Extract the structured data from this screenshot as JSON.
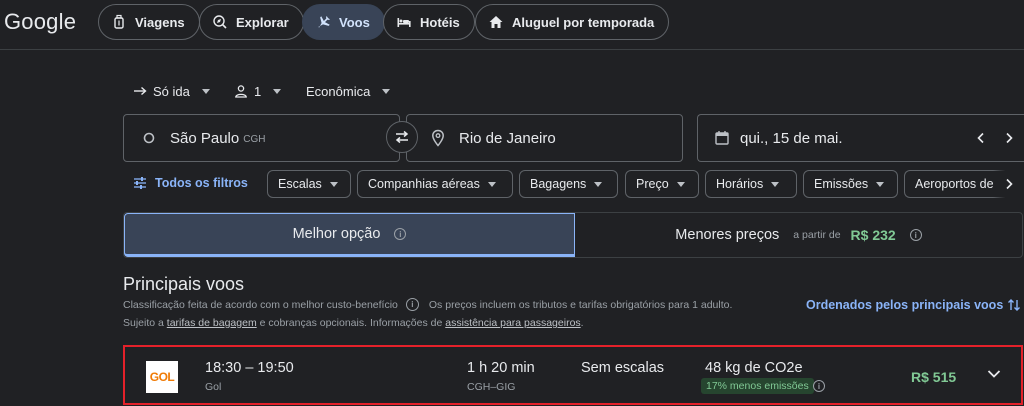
{
  "header": {
    "logo": "Google",
    "nav": [
      {
        "label": "Viagens",
        "icon": "luggage-icon"
      },
      {
        "label": "Explorar",
        "icon": "explore-icon"
      },
      {
        "label": "Voos",
        "icon": "plane-icon",
        "active": true
      },
      {
        "label": "Hotéis",
        "icon": "bed-icon"
      },
      {
        "label": "Aluguel por temporada",
        "icon": "house-icon"
      }
    ]
  },
  "trip": {
    "type": "Só ida",
    "passengers": "1",
    "cabin": "Econômica"
  },
  "search": {
    "origin": "São Paulo",
    "origin_code": "CGH",
    "destination": "Rio de Janeiro",
    "date": "qui., 15 de mai."
  },
  "filters": {
    "all_label": "Todos os filtros",
    "chips": [
      "Escalas",
      "Companhias aéreas",
      "Bagagens",
      "Preço",
      "Horários",
      "Emissões",
      "Aeroportos de"
    ]
  },
  "sort_tabs": {
    "best": "Melhor opção",
    "cheapest": "Menores preços",
    "from_label": "a partir de",
    "from_price": "R$ 232"
  },
  "section": {
    "title": "Principais voos",
    "line1_a": "Classificação feita de acordo com o melhor custo-benefício",
    "line1_b": "Os preços incluem os tributos e tarifas obrigatórios para 1 adulto.",
    "line2_a": "Sujeito a",
    "line2_link1": "tarifas de bagagem",
    "line2_b": "e cobranças opcionais. Informações de",
    "line2_link2": "assistência para passageiros",
    "line2_c": ".",
    "sort_by": "Ordenados pelos principais voos"
  },
  "flight": {
    "logo_text": "GOL",
    "times": "18:30 – 19:50",
    "airline": "Gol",
    "duration": "1 h 20 min",
    "route": "CGH–GIG",
    "stops": "Sem escalas",
    "emissions": "48 kg de CO2e",
    "emissions_badge": "17% menos emissões",
    "price": "R$ 515"
  },
  "colors": {
    "background": "#202124",
    "accent": "#8ab4f8",
    "active_chip": "#394457",
    "price_green": "#81c995",
    "highlight_red": "#e4212a"
  }
}
